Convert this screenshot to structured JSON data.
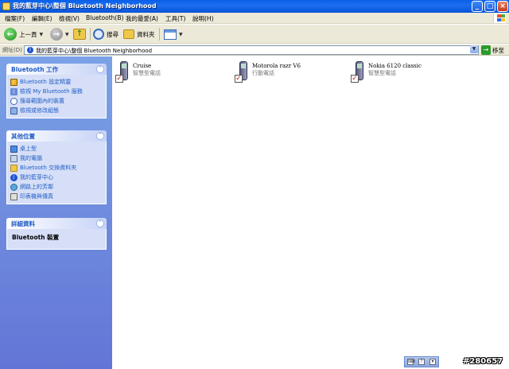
{
  "window": {
    "title": "我的藍芽中心\\整個 Bluetooth Neighborhood",
    "controls": {
      "minimize": "_",
      "maximize": "□",
      "close": "×"
    }
  },
  "menubar": {
    "items": [
      "檔案(F)",
      "編輯(E)",
      "檢視(V)",
      "Bluetooth(B)",
      "我的最愛(A)",
      "工具(T)",
      "說明(H)"
    ]
  },
  "toolbar": {
    "back_label": "上一頁",
    "search_label": "搜尋",
    "folders_label": "資料夾"
  },
  "address": {
    "label": "網址(D)",
    "value": "我的藍芽中心\\整個 Bluetooth Neighborhood",
    "go_label": "移至"
  },
  "tasks_panel": {
    "title": "Bluetooth 工作",
    "items": [
      {
        "label": "Bluetooth 設定精靈",
        "icon": "wizard-icon"
      },
      {
        "label": "檢視 My Bluetooth 服務",
        "icon": "services-icon"
      },
      {
        "label": "搜尋範圍內的裝置",
        "icon": "search-devices-icon"
      },
      {
        "label": "檢視或修改組態",
        "icon": "config-icon"
      }
    ]
  },
  "places_panel": {
    "title": "其他位置",
    "items": [
      {
        "label": "桌上型",
        "icon": "desktop-icon"
      },
      {
        "label": "我的電腦",
        "icon": "my-computer-icon"
      },
      {
        "label": "Bluetooth 交換資料夾",
        "icon": "folder-icon"
      },
      {
        "label": "我的藍芽中心",
        "icon": "bluetooth-icon"
      },
      {
        "label": "網路上的芳鄰",
        "icon": "network-icon"
      },
      {
        "label": "印表機與傳真",
        "icon": "printer-icon"
      }
    ]
  },
  "details_panel": {
    "title": "詳細資料",
    "value": "Bluetooth 裝置"
  },
  "devices": [
    {
      "name": "Cruise",
      "type": "智慧型電話"
    },
    {
      "name": "Motorola razr V6",
      "type": "行動電話"
    },
    {
      "name": "Nokia 6120 classic",
      "type": "智慧型電話"
    }
  ],
  "watermark": "#280657",
  "colors": {
    "title_bar": "#0a5fe8",
    "task_pane": "#6f8fe0",
    "link": "#215dc6"
  }
}
